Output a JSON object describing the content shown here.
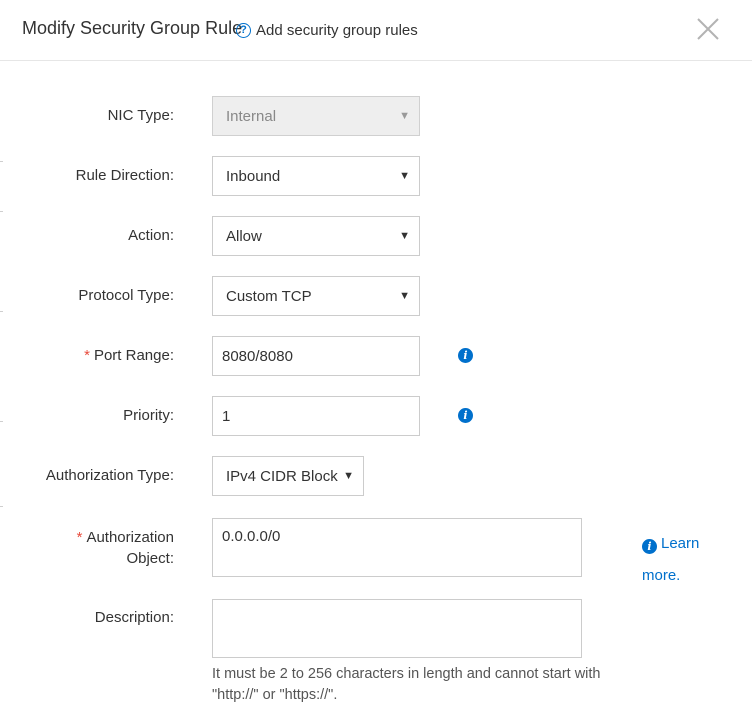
{
  "dialog": {
    "title": "Modify Security Group Rule",
    "help_link_label": "Add security group rules",
    "help_icon": "question-circle-icon",
    "close_icon": "close-icon"
  },
  "form": {
    "nic_type": {
      "label": "NIC Type:",
      "value": "Internal",
      "disabled": true
    },
    "rule_direction": {
      "label": "Rule Direction:",
      "value": "Inbound"
    },
    "action": {
      "label": "Action:",
      "value": "Allow"
    },
    "protocol_type": {
      "label": "Protocol Type:",
      "value": "Custom TCP"
    },
    "port_range": {
      "label": "Port Range:",
      "required_mark": "*",
      "value": "8080/8080",
      "info_icon": "info-icon"
    },
    "priority": {
      "label": "Priority:",
      "value": "1",
      "info_icon": "info-icon"
    },
    "authorization_type": {
      "label": "Authorization Type:",
      "value": "IPv4 CIDR Block"
    },
    "authorization_object": {
      "required_mark": "*",
      "label_line1": "Authorization",
      "label_line2": "Object:",
      "value": "0.0.0.0/0",
      "learn_more_line1": "Learn",
      "learn_more_line2": "more."
    },
    "description": {
      "label": "Description:",
      "value": "",
      "hint": "It must be 2 to 256 characters in length and cannot start with \"http://\" or \"https://\"."
    }
  },
  "colors": {
    "accent": "#0070cc",
    "required": "#e84c3d",
    "border": "#cccccc",
    "disabled_bg": "#eeeeee"
  }
}
